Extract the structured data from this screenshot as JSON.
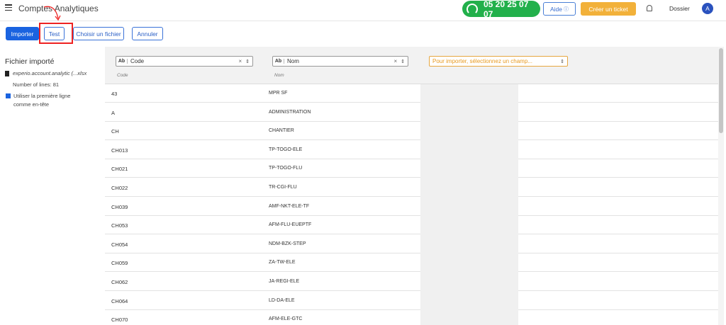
{
  "header": {
    "title": "Comptes Analytiques",
    "phone": "05 20 25 07 07",
    "help_label": "Aide",
    "help_icon": "question-circle-icon",
    "ticket_label": "Créer un ticket",
    "dossier_label": "Dossier",
    "avatar_initial": "A"
  },
  "toolbar": {
    "import_label": "Importer",
    "test_label": "Test",
    "choose_file_label": "Choisir un fichier",
    "cancel_label": "Annuler"
  },
  "sidebar": {
    "title": "Fichier importé",
    "file_name": "experio.account.analytic (...xlsx",
    "lines_count": "Number of lines: 81",
    "header_option": "Utiliser la première ligne comme en-tête"
  },
  "grid": {
    "columns": [
      {
        "field": "Code",
        "sub": "Code"
      },
      {
        "field": "Nom",
        "sub": "Nom"
      }
    ],
    "placeholder_select": "Pour importer, sélectionnez un champ...",
    "rows": [
      [
        "43",
        "MPR SF"
      ],
      [
        "A",
        "ADMINISTRATION"
      ],
      [
        "CH",
        "CHANTIER"
      ],
      [
        "CH013",
        "TP-TOGO-ELE"
      ],
      [
        "CH021",
        "TP-TOGO-FLU"
      ],
      [
        "CH022",
        "TR-CGI-FLU"
      ],
      [
        "CH039",
        "AMF-NKT-ELE-TF"
      ],
      [
        "CH053",
        "AFM-FLU-EUEPTF"
      ],
      [
        "CH054",
        "NDM-BZK-STEP"
      ],
      [
        "CH059",
        "ZA-TW-ELE"
      ],
      [
        "CH062",
        "JA-REGI-ELE"
      ],
      [
        "CH064",
        "LD-DA-ELE"
      ],
      [
        "CH070",
        "AFM-ELE-GTC"
      ]
    ]
  },
  "colors": {
    "primary": "#1a63e0",
    "phone_green": "#22b04b",
    "ticket_orange": "#f2b13a",
    "highlight_red": "#e22"
  }
}
